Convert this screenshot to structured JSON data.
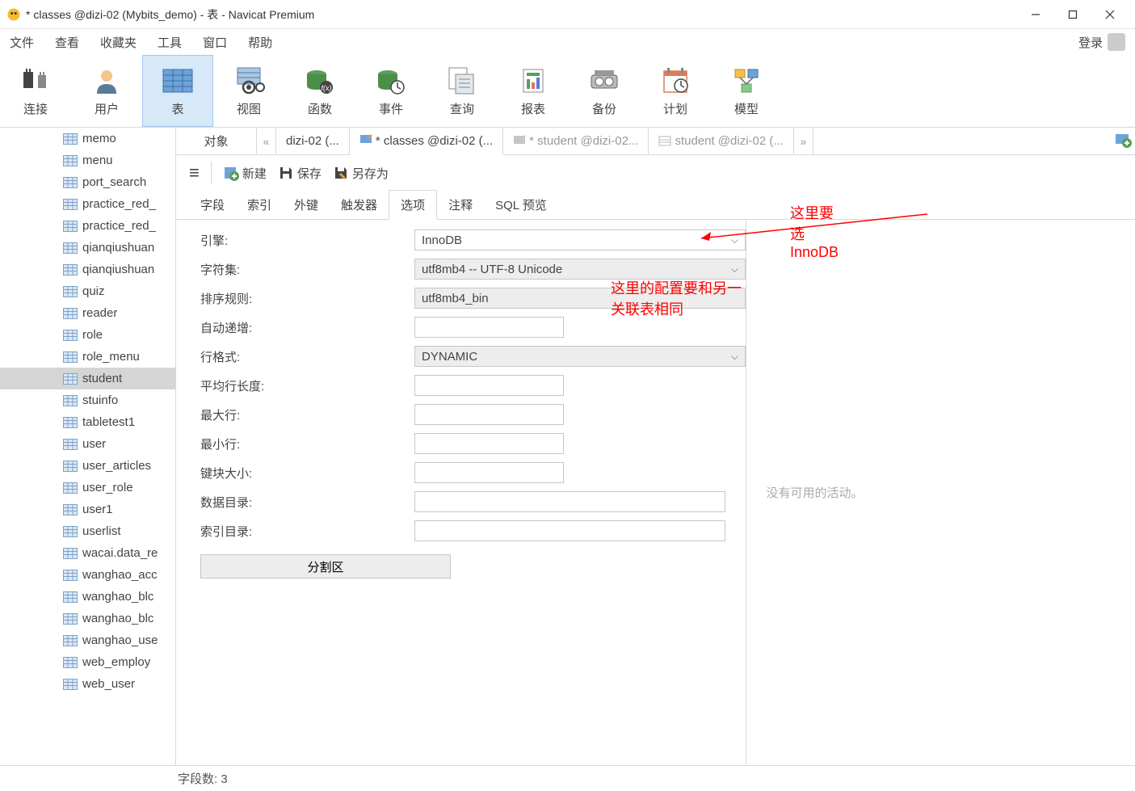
{
  "window": {
    "title": "* classes @dizi-02 (Mybits_demo) - 表 - Navicat Premium"
  },
  "win_controls": {
    "min": "—",
    "max": "▢",
    "close": "✕"
  },
  "menubar": {
    "items": [
      "文件",
      "查看",
      "收藏夹",
      "工具",
      "窗口",
      "帮助"
    ],
    "login": "登录"
  },
  "toolbar": {
    "items": [
      {
        "label": "连接",
        "name": "connect"
      },
      {
        "label": "用户",
        "name": "user"
      },
      {
        "label": "表",
        "name": "table",
        "selected": true
      },
      {
        "label": "视图",
        "name": "view"
      },
      {
        "label": "函数",
        "name": "function"
      },
      {
        "label": "事件",
        "name": "event"
      },
      {
        "label": "查询",
        "name": "query"
      },
      {
        "label": "报表",
        "name": "report"
      },
      {
        "label": "备份",
        "name": "backup"
      },
      {
        "label": "计划",
        "name": "schedule"
      },
      {
        "label": "模型",
        "name": "model"
      }
    ]
  },
  "sidebar": {
    "items": [
      "memo",
      "menu",
      "port_search",
      "practice_red_",
      "practice_red_",
      "qianqiushuan",
      "qianqiushuan",
      "quiz",
      "reader",
      "role",
      "role_menu",
      "student",
      "stuinfo",
      "tabletest1",
      "user",
      "user_articles",
      "user_role",
      "user1",
      "userlist",
      "wacai.data_re",
      "wanghao_acc",
      "wanghao_blc",
      "wanghao_blc",
      "wanghao_use",
      "web_employ",
      "web_user"
    ],
    "selected_index": 11
  },
  "tabs": {
    "items": [
      {
        "label": "对象",
        "type": "plain"
      },
      {
        "label": "dizi-02 (...",
        "type": "nav-left"
      },
      {
        "label": "* classes @dizi-02 (...",
        "type": "pencil",
        "star": true,
        "active": true
      },
      {
        "label": "* student @dizi-02...",
        "type": "pencil",
        "star": true
      },
      {
        "label": "student @dizi-02 (...",
        "type": "table"
      }
    ],
    "nav_right": "»"
  },
  "action_bar": {
    "menu": "≡",
    "new": "新建",
    "save": "保存",
    "saveas": "另存为"
  },
  "sub_tabs": {
    "items": [
      "字段",
      "索引",
      "外键",
      "触发器",
      "选项",
      "注释",
      "SQL 预览"
    ],
    "active_index": 4
  },
  "form": {
    "engine": {
      "label": "引擎:",
      "value": "InnoDB"
    },
    "charset": {
      "label": "字符集:",
      "value": "utf8mb4 -- UTF-8 Unicode"
    },
    "collation": {
      "label": "排序规则:",
      "value": "utf8mb4_bin"
    },
    "autoinc": {
      "label": "自动递增:",
      "value": ""
    },
    "rowformat": {
      "label": "行格式:",
      "value": "DYNAMIC"
    },
    "avgrowlen": {
      "label": "平均行长度:",
      "value": ""
    },
    "maxrows": {
      "label": "最大行:",
      "value": ""
    },
    "minrows": {
      "label": "最小行:",
      "value": ""
    },
    "blocksize": {
      "label": "键块大小:",
      "value": ""
    },
    "datadir": {
      "label": "数据目录:",
      "value": ""
    },
    "indexdir": {
      "label": "索引目录:",
      "value": ""
    },
    "partition": "分割区"
  },
  "right_panel": {
    "text": "没有可用的活动。"
  },
  "status": {
    "field_count": "字段数: 3"
  },
  "annotations": {
    "a1": "这里要选InnoDB",
    "a2": "这里的配置要和另一关联表相同"
  }
}
